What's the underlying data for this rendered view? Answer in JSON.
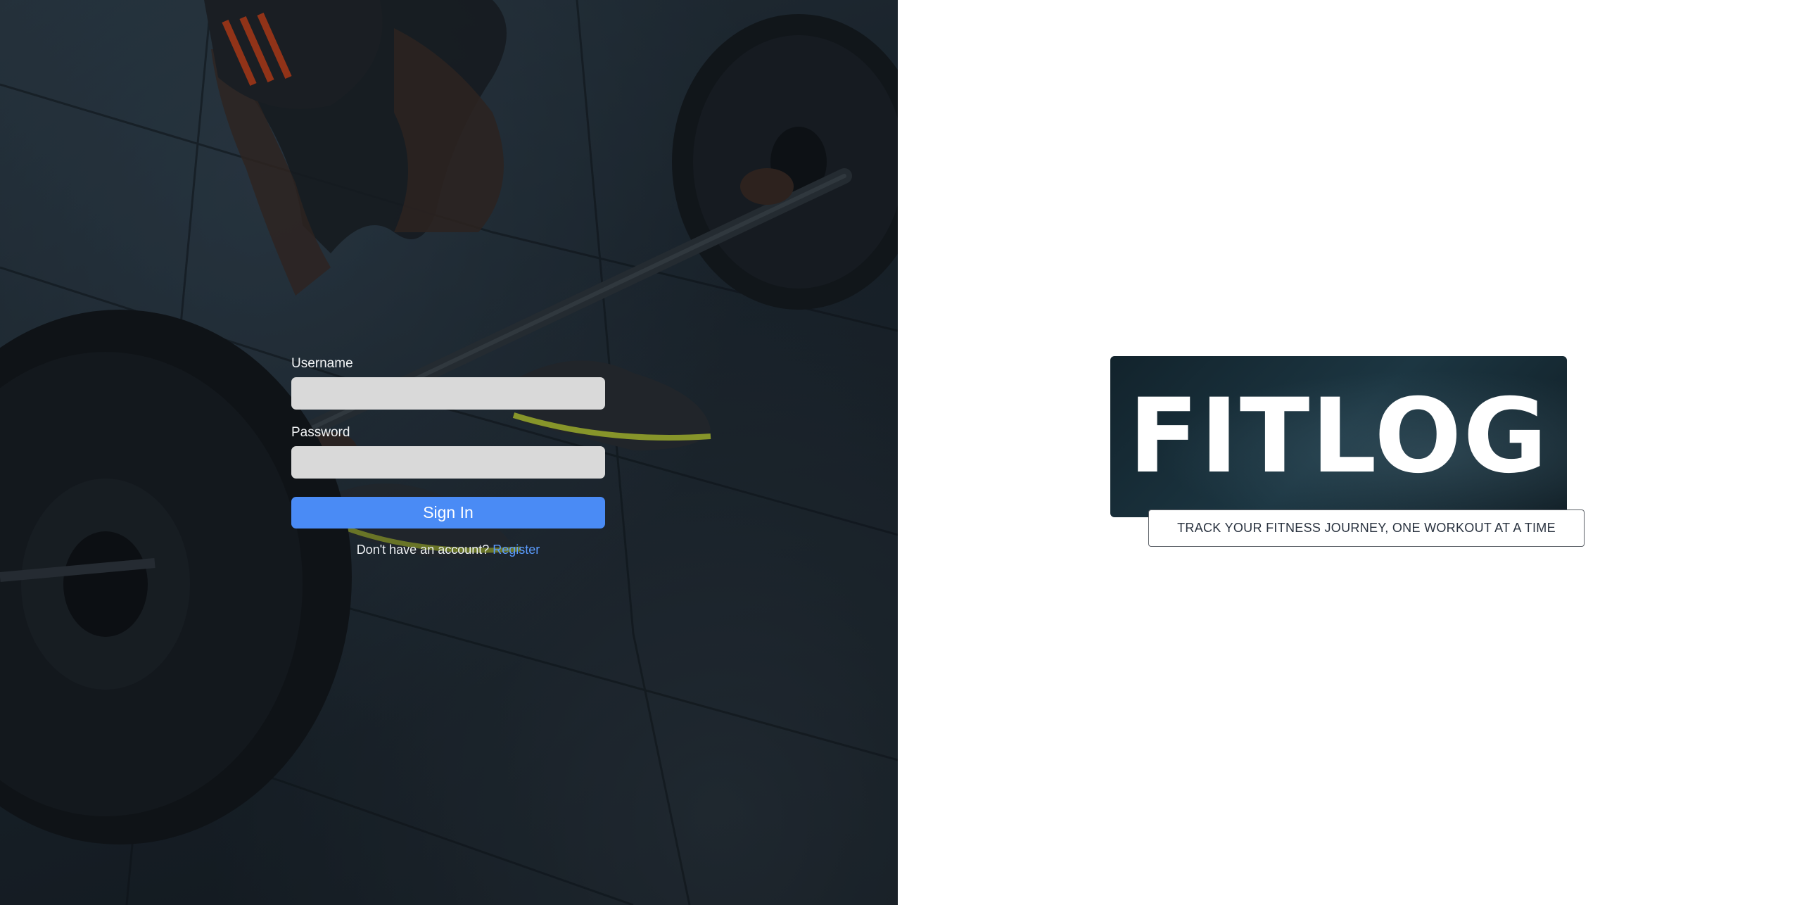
{
  "login": {
    "username_label": "Username",
    "username_value": "",
    "password_label": "Password",
    "password_value": "",
    "signin_label": "Sign In",
    "register_prompt": "Don't have an account?",
    "register_link": "Register"
  },
  "brand": {
    "logo_text": "FITLOG",
    "tagline": "TRACK YOUR FITNESS JOURNEY, ONE WORKOUT AT A TIME"
  },
  "colors": {
    "accent": "#4a8bf5",
    "link": "#5b9cff",
    "input_background": "#d9d9d9",
    "logo_background": "#16303b"
  },
  "background_image": "gym-barbell-deadlift-photo"
}
